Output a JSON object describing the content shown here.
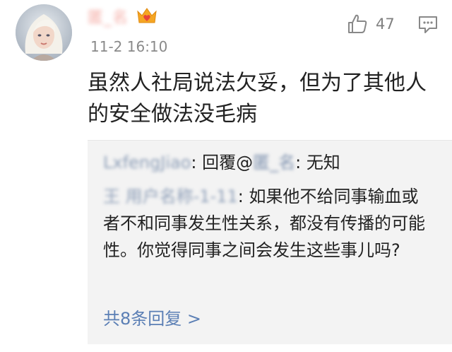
{
  "comment": {
    "username": "匿_名",
    "timestamp": "11-2 16:10",
    "like_count": "47",
    "text": "虽然人社局说法欠妥，但为了其他人的安全做法没毛病",
    "badge_icon": "crown-heart-icon",
    "accent_color": "#f5a623"
  },
  "replies": {
    "reply1": {
      "author": "LxfengJiao",
      "separator": ": ",
      "prefix": "回覆",
      "mention_at": "@",
      "mention": "匿_名",
      "separator2": ": ",
      "text": "无知"
    },
    "reply2": {
      "author": "王 用户名称-1-11",
      "separator": ": ",
      "text": "如果他不给同事输血或者不和同事发生性关系，都没有传播的可能性。你觉得同事之间会发生这些事儿吗?"
    },
    "more_label": "共8条回复 >",
    "link_color": "#5b7fb5"
  }
}
